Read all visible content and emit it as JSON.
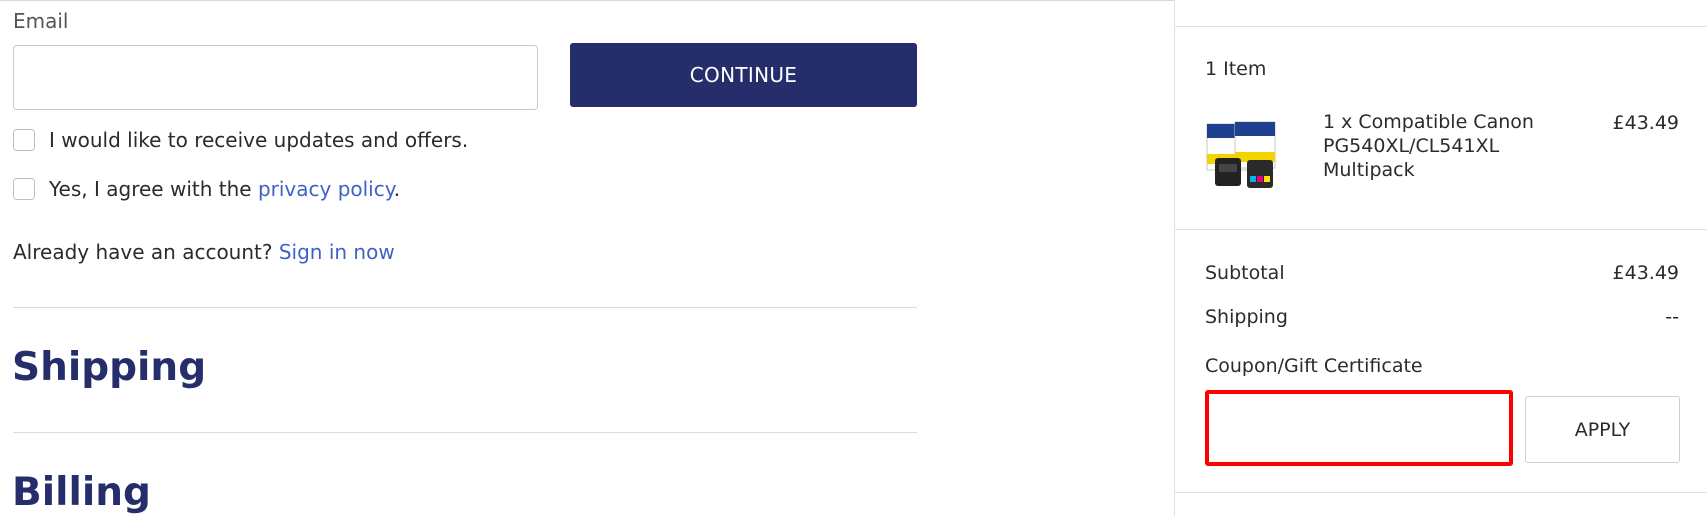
{
  "contact": {
    "email_label": "Email",
    "email_value": "",
    "email_placeholder": "",
    "continue_label": "CONTINUE",
    "updates_label": "I would like to receive updates and offers.",
    "privacy_prefix": "Yes, I agree with the ",
    "privacy_link": "privacy policy",
    "privacy_suffix": ".",
    "account_prefix": "Already have an account? ",
    "sign_in_link": "Sign in now"
  },
  "sections": {
    "shipping_title": "Shipping",
    "billing_title": "Billing"
  },
  "summary": {
    "items_count": "1 Item",
    "product": {
      "name": "1 x Compatible Canon PG540XL/CL541XL Multipack",
      "price": "£43.49",
      "thumbnail_icon": "ink-cartridge-multipack-image"
    },
    "subtotal_label": "Subtotal",
    "subtotal_value": "£43.49",
    "shipping_label": "Shipping",
    "shipping_value": "--",
    "coupon_label": "Coupon/Gift Certificate",
    "coupon_value": "",
    "coupon_placeholder": "",
    "apply_label": "APPLY"
  },
  "colors": {
    "primary_navy": "#252e6b",
    "link_blue": "#3f62c8",
    "highlight_red": "#ff0000"
  }
}
